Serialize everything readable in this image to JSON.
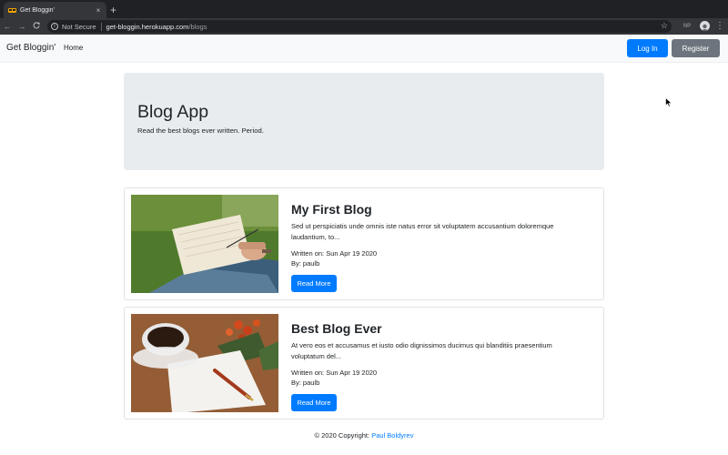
{
  "browser": {
    "tab_title": "Get Bloggin'",
    "tab_close": "×",
    "new_tab": "+",
    "back": "←",
    "forward": "→",
    "reload": "C",
    "security_label": "Not Secure",
    "url_host": "get-bloggin.herokuapp.com",
    "url_path": "/blogs",
    "extension_label": "NP",
    "menu": "⋮",
    "star": "☆"
  },
  "navbar": {
    "brand": "Get Bloggin'",
    "home": "Home",
    "login_label": "Log In",
    "register_label": "Register"
  },
  "jumbotron": {
    "title": "Blog App",
    "lead": "Read the best blogs ever written. Period."
  },
  "posts": [
    {
      "title": "My First Blog",
      "excerpt": "Sed ut perspiciatis unde omnis iste natus error sit voluptatem accusantium doloremque laudantium, to...",
      "written_on": "Written on: Sun Apr 19 2020",
      "author": "By: paulb",
      "button_label": "Read More"
    },
    {
      "title": "Best Blog Ever",
      "excerpt": "At vero eos et accusamus et iusto odio dignissimos ducimus qui blanditiis praesentium voluptatum del...",
      "written_on": "Written on: Sun Apr 19 2020",
      "author": "By: paulb",
      "button_label": "Read More"
    }
  ],
  "footer": {
    "copyright": "© 2020 Copyright:",
    "author_link": "Paul Boldyrev"
  },
  "colors": {
    "primary": "#007bff",
    "secondary": "#6c757d",
    "jumbotron_bg": "#e9ecef",
    "navbar_bg": "#f8f9fa"
  }
}
